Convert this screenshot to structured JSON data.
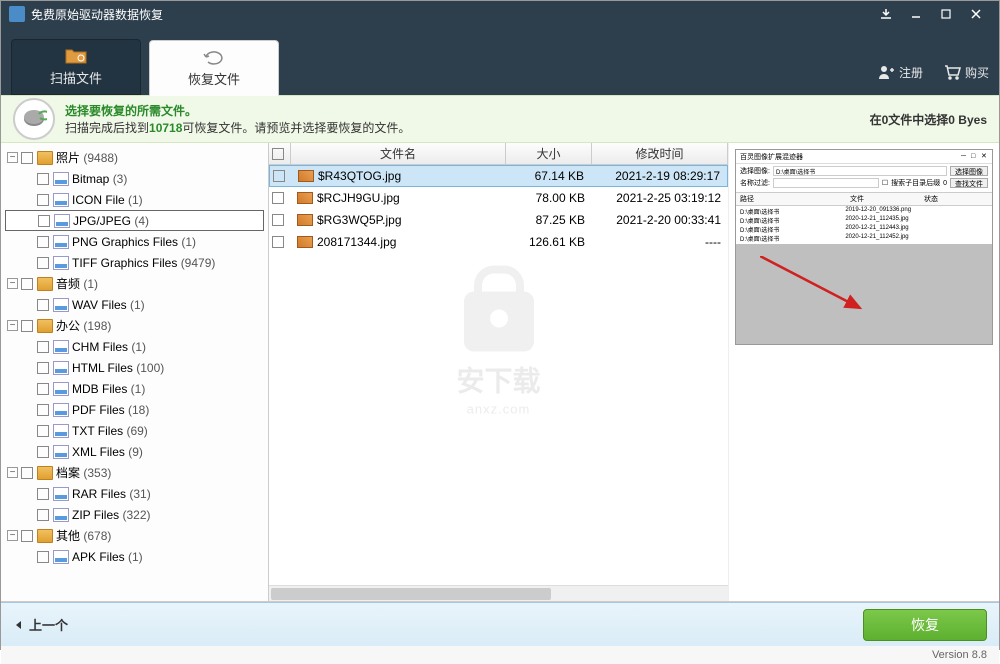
{
  "app": {
    "title": "免费原始驱动器数据恢复"
  },
  "tabs": {
    "scan": "扫描文件",
    "recover": "恢复文件"
  },
  "top_actions": {
    "register": "注册",
    "buy": "购买"
  },
  "info": {
    "heading": "选择要恢复的所需文件。",
    "prefix": "扫描完成后找到",
    "count": "10718",
    "suffix": "可恢复文件。请预览并选择要恢复的文件。",
    "status_prefix": "在",
    "status_mid": "0文件中选择",
    "status_bytes": "0 Byes"
  },
  "tree": {
    "photos": {
      "label": "照片",
      "count": "(9488)"
    },
    "photos_children": [
      {
        "label": "Bitmap",
        "count": "(3)"
      },
      {
        "label": "ICON File",
        "count": "(1)"
      },
      {
        "label": "JPG/JPEG",
        "count": "(4)",
        "selected": true
      },
      {
        "label": "PNG Graphics Files",
        "count": "(1)"
      },
      {
        "label": "TIFF Graphics Files",
        "count": "(9479)"
      }
    ],
    "audio": {
      "label": "音频",
      "count": "(1)"
    },
    "audio_children": [
      {
        "label": "WAV Files",
        "count": "(1)"
      }
    ],
    "office": {
      "label": "办公",
      "count": "(198)"
    },
    "office_children": [
      {
        "label": "CHM Files",
        "count": "(1)"
      },
      {
        "label": "HTML Files",
        "count": "(100)"
      },
      {
        "label": "MDB Files",
        "count": "(1)"
      },
      {
        "label": "PDF Files",
        "count": "(18)"
      },
      {
        "label": "TXT Files",
        "count": "(69)"
      },
      {
        "label": "XML Files",
        "count": "(9)"
      }
    ],
    "archive": {
      "label": "档案",
      "count": "(353)"
    },
    "archive_children": [
      {
        "label": "RAR Files",
        "count": "(31)"
      },
      {
        "label": "ZIP Files",
        "count": "(322)"
      }
    ],
    "other": {
      "label": "其他",
      "count": "(678)"
    },
    "other_children": [
      {
        "label": "APK Files",
        "count": "(1)"
      }
    ]
  },
  "file_headers": {
    "name": "文件名",
    "size": "大小",
    "modified": "修改时间"
  },
  "files": [
    {
      "name": "$R43QTOG.jpg",
      "size": "67.14 KB",
      "date": "2021-2-19 08:29:17",
      "selected": true
    },
    {
      "name": "$RCJH9GU.jpg",
      "size": "78.00 KB",
      "date": "2021-2-25 03:19:12"
    },
    {
      "name": "$RG3WQ5P.jpg",
      "size": "87.25 KB",
      "date": "2021-2-20 00:33:41"
    },
    {
      "name": "208171344.jpg",
      "size": "126.61 KB",
      "date": "----"
    }
  ],
  "watermark": {
    "chinese": "安下载",
    "pinyin": "anxz.com"
  },
  "preview": {
    "title": "百灵图像扩展混迹器",
    "label_select": "选择图像:",
    "select_value": "D:\\桌面\\选择书",
    "btn_browse": "选择图像",
    "label_name": "名称过滤:",
    "chk_subdir": "搜索子目录后缀",
    "btn_search": "查找文件",
    "count": "0",
    "hdr_path": "路径",
    "hdr_file": "文件",
    "hdr_status": "状态",
    "rows": [
      {
        "path": "D:\\桌面\\选择书",
        "file": "2019-12-20_091336.png"
      },
      {
        "path": "D:\\桌面\\选择书",
        "file": "2020-12-21_112435.jpg"
      },
      {
        "path": "D:\\桌面\\选择书",
        "file": "2020-12-21_112443.jpg"
      },
      {
        "path": "D:\\桌面\\选择书",
        "file": "2020-12-21_112452.jpg"
      }
    ]
  },
  "footer": {
    "back": "上一个",
    "restore": "恢复"
  },
  "version": "Version 8.8"
}
